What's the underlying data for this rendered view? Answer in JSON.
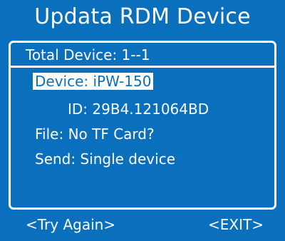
{
  "title": "Updata RDM Device",
  "panel": {
    "total_device": "Total Device: 1--1",
    "device": "Device: iPW-150",
    "id": "ID: 29B4.121064BD",
    "file": "File: No TF Card?",
    "send": "Send: Single device"
  },
  "footer": {
    "try_again": "<Try Again>",
    "exit": "<EXIT>"
  },
  "colors": {
    "background": "#0a6fbd",
    "text": "#ffffff",
    "highlight_text": "#0a6fbd",
    "highlight_bg": "#ffffff"
  }
}
